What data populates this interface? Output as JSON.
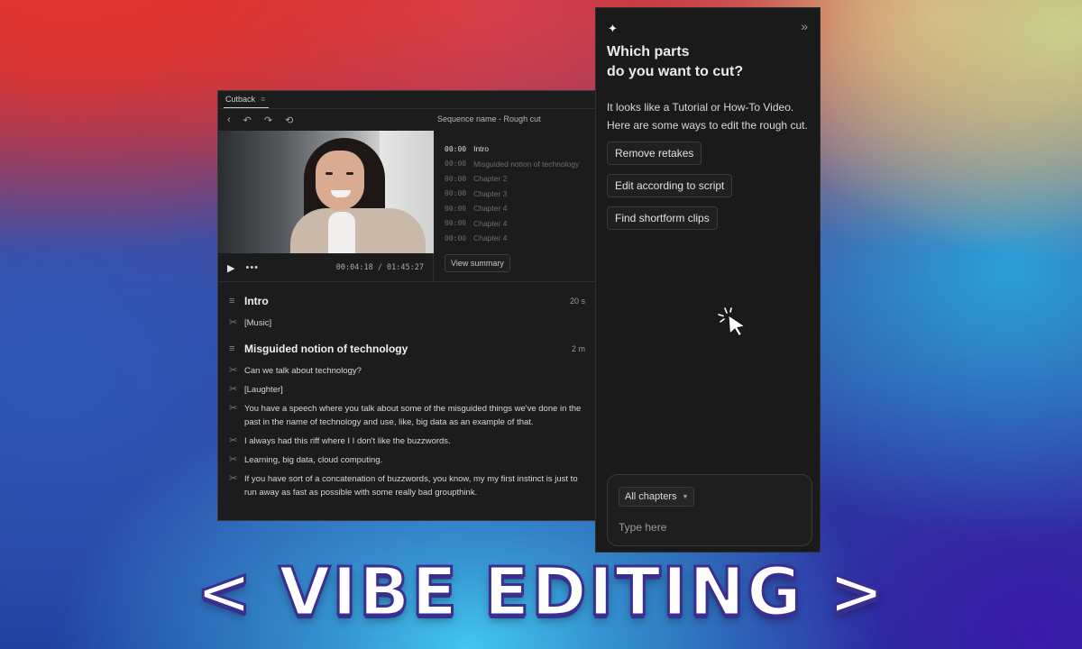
{
  "editor": {
    "tab_label": "Cutback",
    "tab_menu_icon": "≡",
    "sequence_name": "Sequence name - Rough cut",
    "player": {
      "time": "00:04:18 / 01:45:27"
    },
    "chapters": [
      {
        "time": "00:00",
        "label": "Intro"
      },
      {
        "time": "00:00",
        "label": "Misguided notion of technology"
      },
      {
        "time": "00:00",
        "label": "Chapter 2"
      },
      {
        "time": "00:00",
        "label": "Chapter 3"
      },
      {
        "time": "00:00",
        "label": "Chapter 4"
      },
      {
        "time": "00:00",
        "label": "Chapter 4"
      },
      {
        "time": "00:00",
        "label": "Chapter 4"
      }
    ],
    "view_summary_label": "View summary",
    "sections": [
      {
        "title": "Intro",
        "duration": "20 s",
        "lines": [
          "[Music]"
        ]
      },
      {
        "title": "Misguided notion of technology",
        "duration": "2 m",
        "lines": [
          "Can we talk about technology?",
          "[Laughter]",
          "You have a speech where you talk about some of the misguided things we've done in the past in the name of technology and use, like, big data as an example of that.",
          "I always had this riff where I I don't like the buzzwords.",
          "Learning, big data, cloud computing.",
          "If you have sort of a concatenation of buzzwords, you know, my my first instinct is just to run away as fast as possible with some really bad groupthink."
        ]
      }
    ]
  },
  "panel": {
    "question_line1": "Which parts",
    "question_line2": "do you want to cut?",
    "intro": "It looks like a Tutorial or How-To Video. Here are some ways to edit the rough cut.",
    "options": [
      "Remove retakes",
      "Edit according to script",
      "Find shortform clips"
    ],
    "chapter_filter": "All chapters",
    "input_placeholder": "Type here"
  },
  "banner_text": "< VIBE EDITING >",
  "icons": {
    "sparkle": "sparkle-icon",
    "collapse": "double-chevron-right-icon",
    "cursor": "click-cursor-icon"
  }
}
